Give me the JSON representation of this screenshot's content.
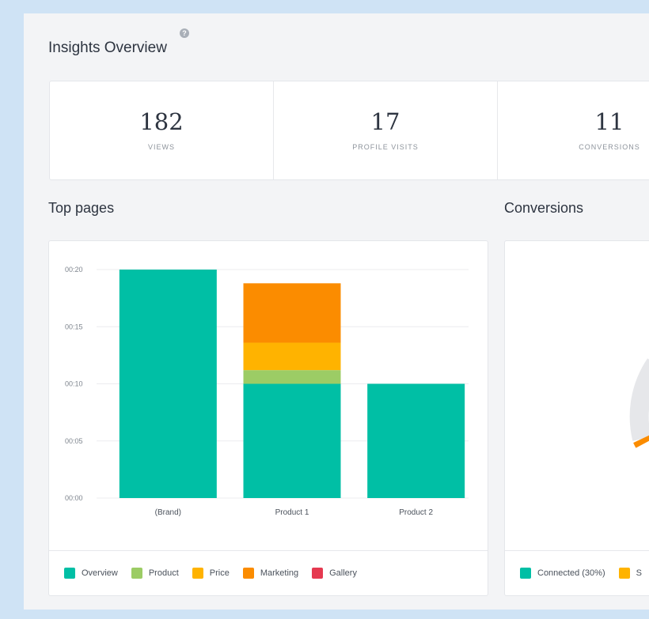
{
  "header": {
    "title": "Insights Overview",
    "help_icon": "question-circle-icon"
  },
  "stats": [
    {
      "value": "182",
      "label": "VIEWS"
    },
    {
      "value": "17",
      "label": "PROFILE VISITS"
    },
    {
      "value": "11",
      "label": "CONVERSIONS"
    }
  ],
  "top_pages": {
    "title": "Top pages",
    "legend": [
      {
        "label": "Overview",
        "color": "#00bfa5"
      },
      {
        "label": "Product",
        "color": "#9ccc65"
      },
      {
        "label": "Price",
        "color": "#ffb300"
      },
      {
        "label": "Marketing",
        "color": "#fb8c00"
      },
      {
        "label": "Gallery",
        "color": "#e53950"
      }
    ]
  },
  "conversions": {
    "title": "Conversions",
    "legend": [
      {
        "label": "Connected (30%)",
        "color": "#00bfa5"
      },
      {
        "label": "S",
        "color": "#ffb300"
      }
    ]
  },
  "chart_data": {
    "type": "bar",
    "stacked": true,
    "categories": [
      "(Brand)",
      "Product 1",
      "Product 2"
    ],
    "y_ticks": [
      "00:00",
      "00:05",
      "00:10",
      "00:15",
      "00:20"
    ],
    "ylim": [
      0,
      20
    ],
    "grid": true,
    "unit": "seconds",
    "series": [
      {
        "name": "Overview",
        "color": "#00bfa5",
        "values": [
          20,
          10,
          10
        ]
      },
      {
        "name": "Product",
        "color": "#9ccc65",
        "values": [
          0,
          1.2,
          0
        ]
      },
      {
        "name": "Price",
        "color": "#ffb300",
        "values": [
          0,
          2.4,
          0
        ]
      },
      {
        "name": "Marketing",
        "color": "#fb8c00",
        "values": [
          0,
          5.2,
          0
        ]
      },
      {
        "name": "Gallery",
        "color": "#e53950",
        "values": [
          0,
          0,
          0
        ]
      }
    ]
  }
}
